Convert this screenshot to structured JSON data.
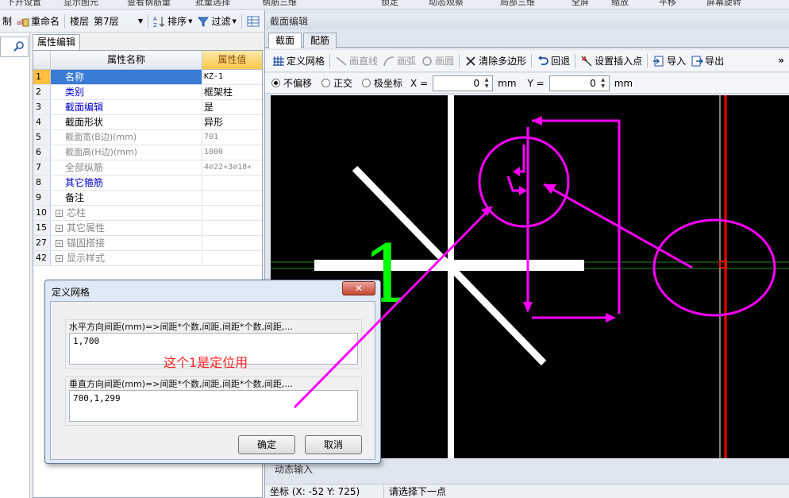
{
  "top_strip": {
    "items": [
      "下开设置",
      "显示图元",
      "查看钢筋量",
      "批量选择",
      "钢筋三维",
      "",
      "锁定",
      "动态观察",
      "局部三维",
      "全屏",
      "缩放",
      "平移",
      "屏幕旋转"
    ]
  },
  "toolbar": {
    "item0": "制",
    "rename": "重命名",
    "floor_label": "楼层",
    "floor_value": "第7层",
    "sort": "排序",
    "filter": "过滤"
  },
  "property_panel": {
    "tab": "属性编辑",
    "col_name": "属性名称",
    "col_value": "属性值",
    "rows": [
      {
        "no": "1",
        "name": "名称",
        "value": "KZ-1"
      },
      {
        "no": "2",
        "name": "类别",
        "value": "框架柱"
      },
      {
        "no": "3",
        "name": "截面编辑",
        "value": "是"
      },
      {
        "no": "4",
        "name": "截面形状",
        "value": "异形"
      },
      {
        "no": "5",
        "name": "截面宽(B边)(mm)",
        "value": "701"
      },
      {
        "no": "6",
        "name": "截面高(H边)(mm)",
        "value": "1000"
      },
      {
        "no": "7",
        "name": "全部纵筋",
        "value": "4⌀22+3⌀18+"
      },
      {
        "no": "8",
        "name": "其它箍筋",
        "value": ""
      },
      {
        "no": "9",
        "name": "备注",
        "value": ""
      },
      {
        "no": "10",
        "name": "芯柱",
        "value": ""
      },
      {
        "no": "15",
        "name": "其它属性",
        "value": ""
      },
      {
        "no": "27",
        "name": "锚固搭接",
        "value": ""
      },
      {
        "no": "42",
        "name": "显示样式",
        "value": ""
      }
    ]
  },
  "section_window": {
    "title": "截面编辑",
    "tabs": [
      "截面",
      "配筋"
    ],
    "tools": {
      "define_grid": "定义网格",
      "line": "画直线",
      "arc": "画弧",
      "circle": "画圆",
      "clear_polygon": "清除多边形",
      "undo": "回退",
      "set_insert": "设置插入点",
      "import": "导入",
      "export": "导出",
      "more": "»"
    },
    "coords": {
      "no_offset": "不偏移",
      "ortho": "正交",
      "polar": "极坐标",
      "x_label": "X =",
      "x_value": "0",
      "x_unit": "mm",
      "y_label": "Y =",
      "y_value": "0",
      "y_unit": "mm"
    },
    "canvas_label": "1",
    "dynamic_input": "动态输入",
    "status_coord": "坐标 (X: -52 Y: 725)",
    "status_msg": "请选择下一点"
  },
  "dialog": {
    "title": "定义网格",
    "close": "✕",
    "h_label": "水平方向间距(mm)=>间距*个数,间距,间距*个数,间距,...",
    "h_value": "1,700",
    "annotation": "这个1是定位用",
    "v_label": "垂直方向间距(mm)=>间距*个数,间距,间距*个数,间距,...",
    "v_value": "700,1,299",
    "ok": "确定",
    "cancel": "取消"
  },
  "colors": {
    "annotation_magenta": "#ff00ff",
    "cursor_red": "#ff0000",
    "label_green": "#00ff00",
    "selected_row": "#3a7bd5"
  }
}
